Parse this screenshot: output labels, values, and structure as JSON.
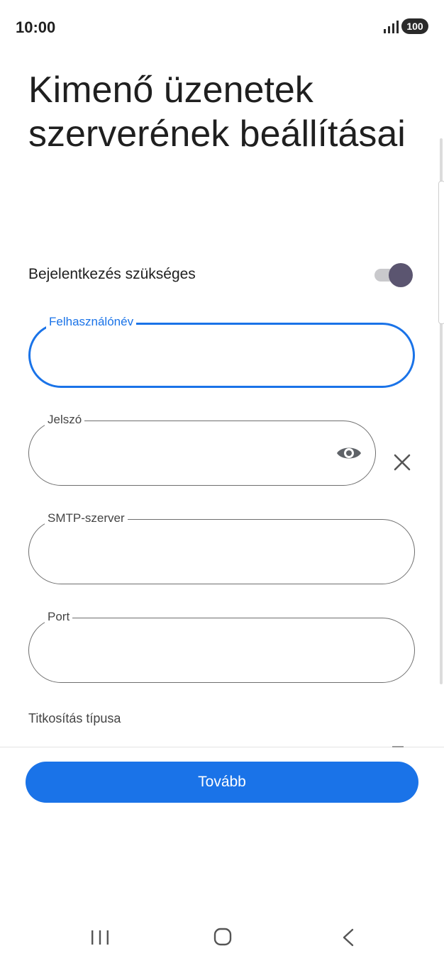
{
  "status_bar": {
    "time": "10:00",
    "battery": "100",
    "signal_icon": "signal-bars-icon"
  },
  "page": {
    "title": "Kimenő üzenetek szerverének beállításai"
  },
  "login_required": {
    "label": "Bejelentkezés szükséges",
    "enabled": true
  },
  "fields": {
    "username": {
      "label": "Felhasználónév",
      "value": ""
    },
    "password": {
      "label": "Jelszó",
      "value": "",
      "visibility_icon": "eye-icon",
      "clear_icon": "close-icon"
    },
    "smtp_server": {
      "label": "SMTP-szerver",
      "value": ""
    },
    "port": {
      "label": "Port",
      "value": ""
    }
  },
  "encryption": {
    "label": "Titkosítás típusa"
  },
  "actions": {
    "next_label": "Tovább"
  },
  "nav": {
    "recent_icon": "recent-apps-icon",
    "home_icon": "home-icon",
    "back_icon": "back-icon"
  },
  "colors": {
    "accent": "#1a73e8",
    "toggle_thumb": "#5b5570",
    "toggle_track": "#c9c9cc"
  }
}
